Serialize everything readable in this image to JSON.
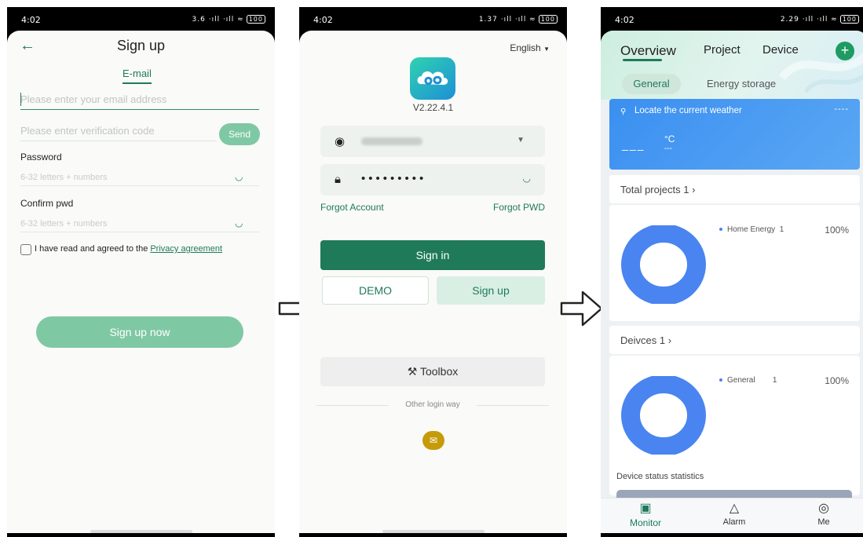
{
  "colors": {
    "accent": "#1f7a5a",
    "accent_light": "#7fc8a4",
    "chart": "#4a84f0",
    "weather": "#3a8ff0"
  },
  "signup_screen": {
    "status_time": "4:02",
    "status_icons": "3.6 ‧ıll ‧ıll ≈",
    "battery": "100",
    "back_icon": "arrow-left-icon",
    "title": "Sign up",
    "tab_email": "E-mail",
    "email_placeholder": "Please enter your email address",
    "code_placeholder": "Please enter verification code",
    "send_label": "Send",
    "password_label": "Password",
    "password_placeholder": "6-32 letters + numbers",
    "confirm_label": "Confirm pwd",
    "confirm_placeholder": "6-32 letters + numbers",
    "agree_text": "I have read and agreed to the",
    "privacy_link": "Privacy agreement",
    "submit_label": "Sign up now"
  },
  "signin_screen": {
    "status_time": "4:02",
    "status_icons": "1.37 ‧ıll ‧ıll ≈",
    "battery": "100",
    "language": "English",
    "version": "V2.22.4.1",
    "password_dots": "•••••••••",
    "forgot_account": "Forgot Account",
    "forgot_pwd": "Forgot PWD",
    "signin_label": "Sign in",
    "demo_label": "DEMO",
    "signup_label": "Sign up",
    "toolbox_label": "Toolbox",
    "other_login": "Other login way"
  },
  "overview_screen": {
    "status_time": "4:02",
    "status_icons": "2.29 ‧ıll ‧ıll ≈",
    "battery": "100",
    "tabs": [
      "Overview",
      "Project",
      "Device"
    ],
    "subtabs": [
      "General",
      "Energy storage"
    ],
    "weather": {
      "locate": "Locate the current weather",
      "top_right": "----",
      "temp": "___",
      "unit": "°C",
      "sub": "---"
    },
    "projects": {
      "title": "Total projects 1",
      "legend_label": "Home Energy",
      "legend_count": "1",
      "percent": "100%"
    },
    "devices": {
      "title": "Deivces 1",
      "legend_label": "General",
      "legend_count": "1",
      "percent": "100%"
    },
    "status_title": "Device status statistics",
    "nav": [
      "Monitor",
      "Alarm",
      "Me"
    ]
  }
}
